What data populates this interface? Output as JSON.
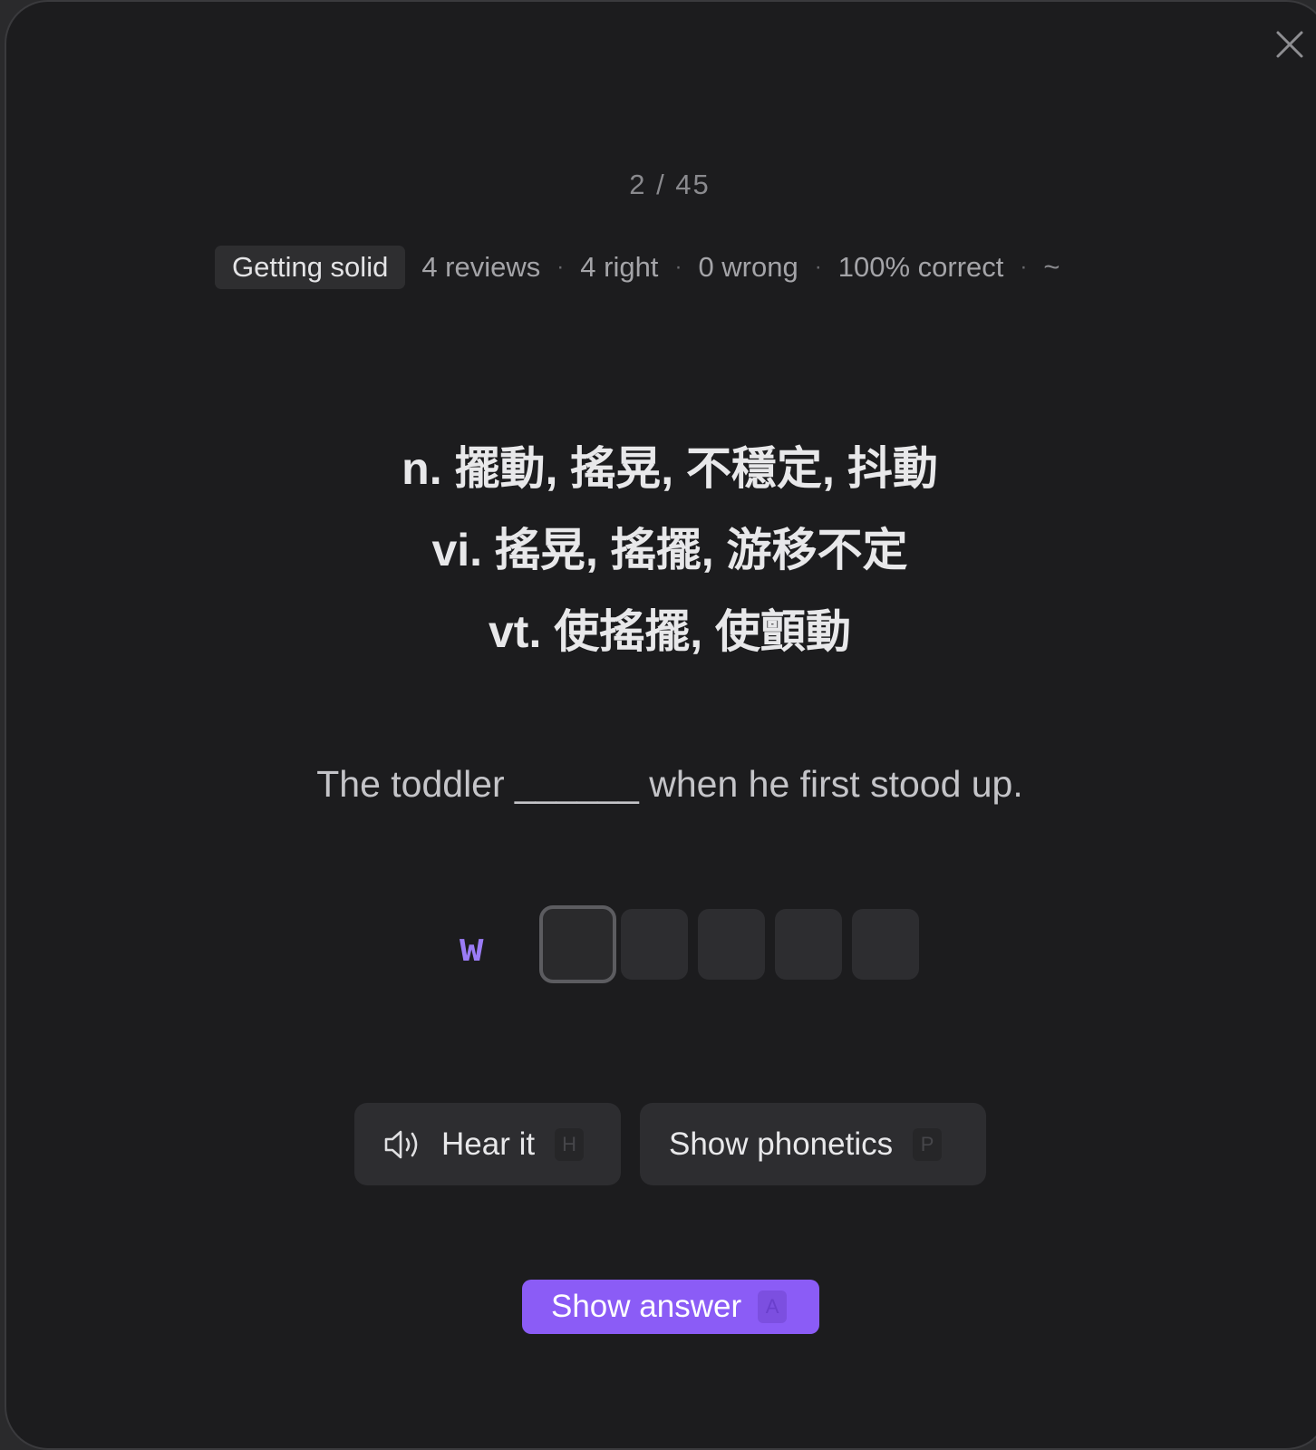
{
  "progress": {
    "current": "2",
    "total": "45",
    "label": "2 / 45"
  },
  "stats": {
    "level": "Getting solid",
    "reviews": "4 reviews",
    "right": "4 right",
    "wrong": "0 wrong",
    "accuracy": "100% correct",
    "separator": "·",
    "trend": "~"
  },
  "definitions": [
    "n. 擺動, 搖晃, 不穩定, 抖動",
    "vi. 搖晃, 搖擺, 游移不定",
    "vt. 使搖擺, 使顫動"
  ],
  "sentence": "The toddler ______ when he first stood up.",
  "answer_input": {
    "first_letter": "w",
    "remaining_letter_count": 5,
    "active_index": 0
  },
  "actions": {
    "hear": {
      "label": "Hear it",
      "shortcut": "H",
      "icon": "speaker-icon"
    },
    "phonetics": {
      "label": "Show phonetics",
      "shortcut": "P"
    },
    "answer": {
      "label": "Show answer",
      "shortcut": "A"
    }
  },
  "close_icon": "close-icon",
  "colors": {
    "accent": "#8b5cf6",
    "first_letter": "#9b7cf6",
    "background": "#1c1c1e",
    "button": "#2d2d30"
  }
}
